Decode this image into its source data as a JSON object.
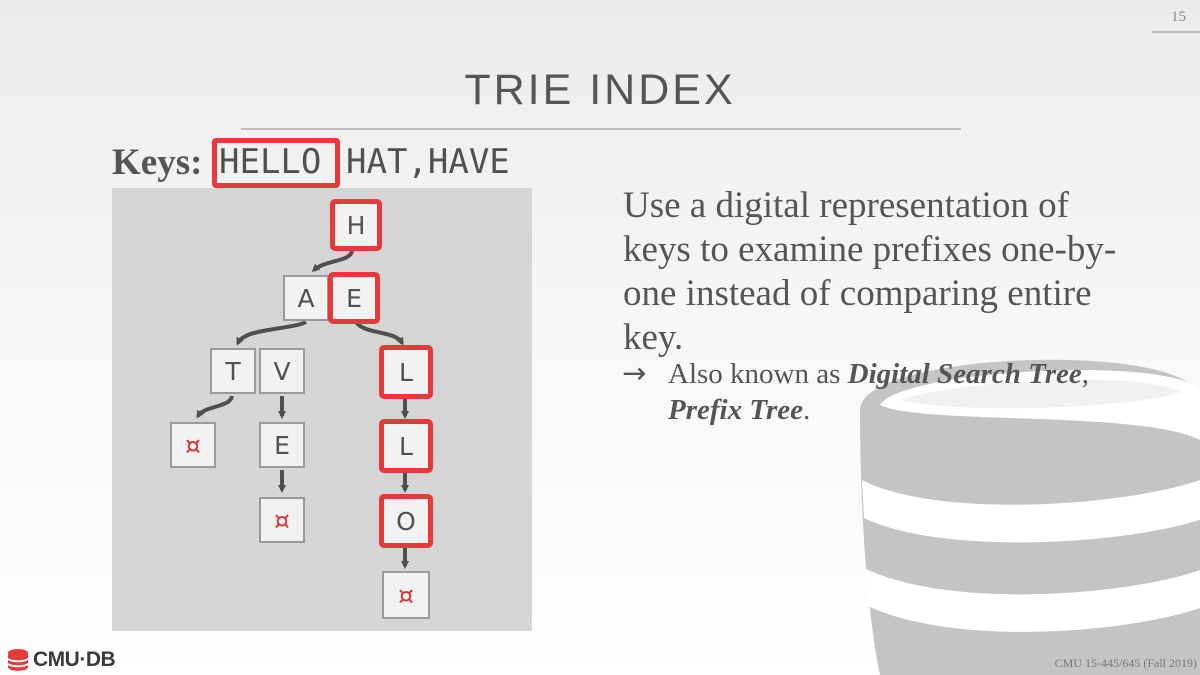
{
  "page_number": "15",
  "title": "TRIE INDEX",
  "keys": {
    "label": "Keys:",
    "highlighted": "HELLO",
    "others": "HAT,HAVE"
  },
  "trie": {
    "nodes": {
      "h": "H",
      "a": "A",
      "e1": "E",
      "t": "T",
      "v": "V",
      "l1": "L",
      "l2": "L",
      "o": "O",
      "e2": "E",
      "term1": "¤",
      "term2": "¤",
      "term3": "¤"
    },
    "highlight_color": "#e5393c"
  },
  "body": {
    "text": "Use a digital representation of keys to examine prefixes one-by-one instead of comparing entire key.",
    "bullet_arrow": "→",
    "bullet_prefix": "Also known as ",
    "term1": "Digital Search Tree",
    "sep": ",",
    "term2": "Prefix Tree",
    "end": "."
  },
  "logo_text": "CMU·DB",
  "footer": "CMU 15-445/645 (Fall 2019)"
}
